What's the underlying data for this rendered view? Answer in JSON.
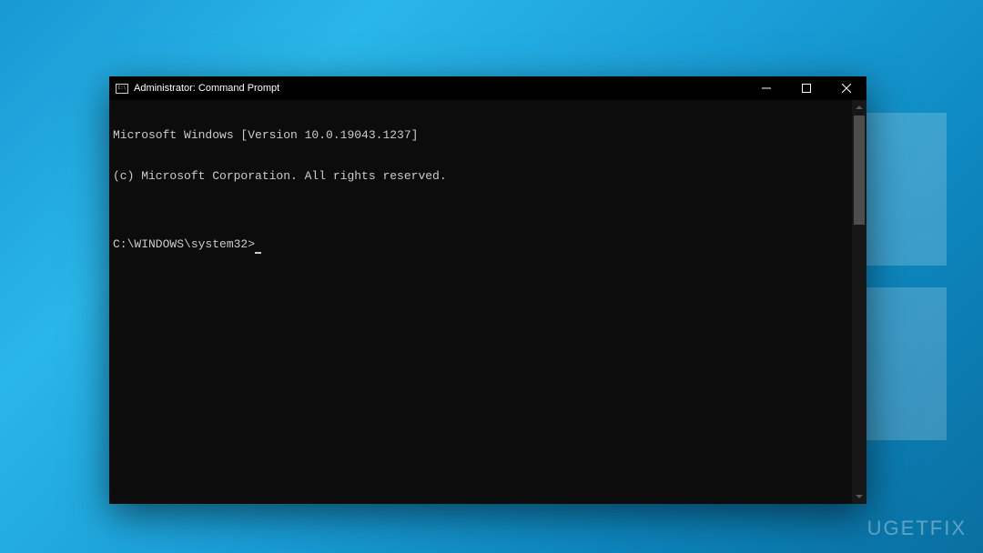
{
  "window": {
    "title": "Administrator: Command Prompt"
  },
  "terminal": {
    "line1": "Microsoft Windows [Version 10.0.19043.1237]",
    "line2": "(c) Microsoft Corporation. All rights reserved.",
    "blank": "",
    "prompt": "C:\\WINDOWS\\system32>"
  },
  "watermark": "UGETFIX"
}
